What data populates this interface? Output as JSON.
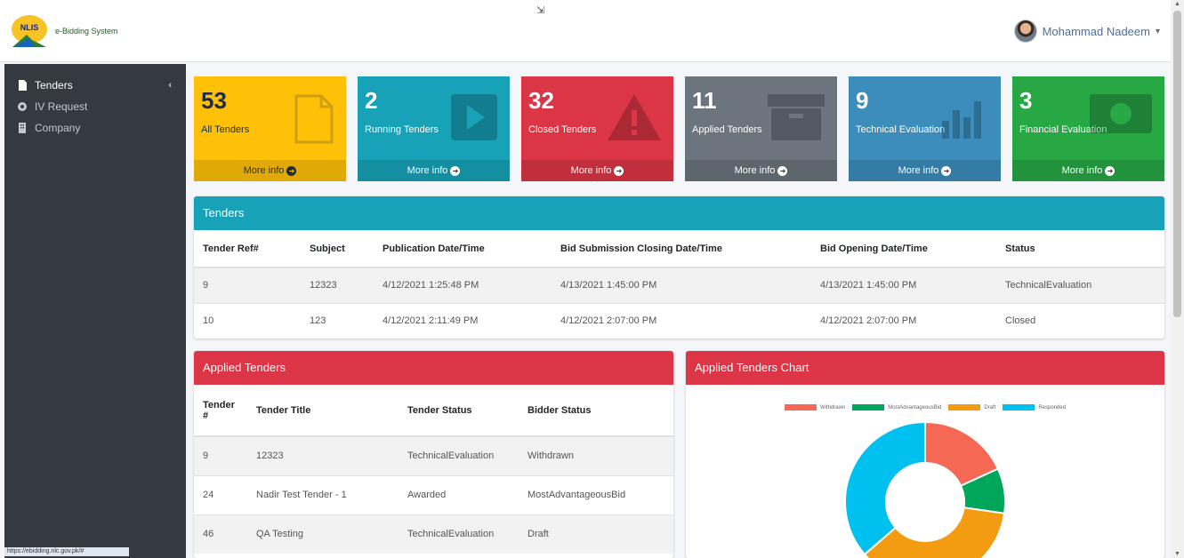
{
  "header": {
    "logo_abbr": "NLIS",
    "logo_line1": "e-Bidding System",
    "user_name": "Mohammad Nadeem",
    "user_caret": "▾"
  },
  "sidebar": {
    "items": [
      {
        "label": "Tenders",
        "icon": "file-icon",
        "active": true,
        "caret": "‹"
      },
      {
        "label": "IV Request",
        "icon": "gears-icon",
        "active": false
      },
      {
        "label": "Company",
        "icon": "building-icon",
        "active": false
      }
    ],
    "status_url": "https://ebidding.nlc.gov.pk/#"
  },
  "boxes": [
    {
      "num": "53",
      "label": "All Tenders",
      "more": "More info",
      "color": "#ffc107"
    },
    {
      "num": "2",
      "label": "Running Tenders",
      "more": "More info",
      "color": "#17a2b8"
    },
    {
      "num": "32",
      "label": "Closed Tenders",
      "more": "More info",
      "color": "#dc3545"
    },
    {
      "num": "11",
      "label": "Applied Tenders",
      "more": "More info",
      "color": "#6c757d"
    },
    {
      "num": "9",
      "label": "Technical Evaluation",
      "more": "More info",
      "color": "#3c8dbc"
    },
    {
      "num": "3",
      "label": "Financial Evaluation",
      "more": "More info",
      "color": "#28a745"
    }
  ],
  "tenders": {
    "title": "Tenders",
    "columns": [
      "Tender Ref#",
      "Subject",
      "Publication Date/Time",
      "Bid Submission Closing Date/Time",
      "Bid Opening Date/Time",
      "Status"
    ],
    "rows": [
      [
        "9",
        "12323",
        "4/12/2021 1:25:48 PM",
        "4/13/2021 1:45:00 PM",
        "4/13/2021 1:45:00 PM",
        "TechnicalEvaluation"
      ],
      [
        "10",
        "123",
        "4/12/2021 2:11:49 PM",
        "4/12/2021 2:07:00 PM",
        "4/12/2021 2:07:00 PM",
        "Closed"
      ]
    ]
  },
  "applied": {
    "title": "Applied Tenders",
    "columns": [
      "Tender #",
      "Tender Title",
      "Tender Status",
      "Bidder Status"
    ],
    "rows": [
      [
        "9",
        "12323",
        "TechnicalEvaluation",
        "Withdrawn"
      ],
      [
        "24",
        "Nadir Test Tender - 1",
        "Awarded",
        "MostAdvantageousBid"
      ],
      [
        "46",
        "QA Testing",
        "TechnicalEvaluation",
        "Draft"
      ]
    ]
  },
  "chart_card": {
    "title": "Applied Tenders Chart"
  },
  "chart_data": {
    "type": "pie",
    "title": "",
    "categories": [
      "Withdrawn",
      "MostAdvantageousBid",
      "Draft",
      "Responded"
    ],
    "values": [
      2,
      1,
      4,
      4
    ],
    "colors": [
      "#f56954",
      "#00a65a",
      "#f39c12",
      "#00c0ef"
    ],
    "legend": "top"
  }
}
